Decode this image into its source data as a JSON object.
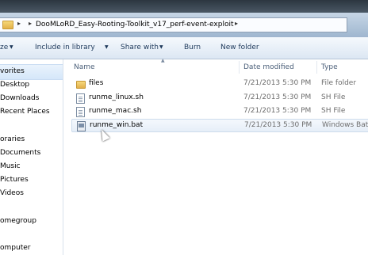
{
  "address": {
    "path_label": "DooMLoRD_Easy-Rooting-Toolkit_v17_perf-event-exploit"
  },
  "toolbar": {
    "organize": "ze",
    "include_in_library": "Include in library",
    "share_with": "Share with",
    "burn": "Burn",
    "new_folder": "New folder"
  },
  "nav": {
    "items": [
      {
        "label": "vorites"
      },
      {
        "label": "Desktop"
      },
      {
        "label": "Downloads"
      },
      {
        "label": "Recent Places"
      },
      {
        "label": "oraries"
      },
      {
        "label": "Documents"
      },
      {
        "label": "Music"
      },
      {
        "label": "Pictures"
      },
      {
        "label": "Videos"
      },
      {
        "label": "omegroup"
      },
      {
        "label": "omputer"
      }
    ]
  },
  "columns": {
    "name": "Name",
    "date_modified": "Date modified",
    "type": "Type"
  },
  "files": [
    {
      "name": "files",
      "date": "7/21/2013 5:30 PM",
      "type": "File folder",
      "icon": "folder-icon"
    },
    {
      "name": "runme_linux.sh",
      "date": "7/21/2013 5:30 PM",
      "type": "SH File",
      "icon": "sh-file-icon"
    },
    {
      "name": "runme_mac.sh",
      "date": "7/21/2013 5:30 PM",
      "type": "SH File",
      "icon": "sh-file-icon"
    },
    {
      "name": "runme_win.bat",
      "date": "7/21/2013 5:30 PM",
      "type": "Windows Batc",
      "icon": "bat-file-icon"
    }
  ]
}
